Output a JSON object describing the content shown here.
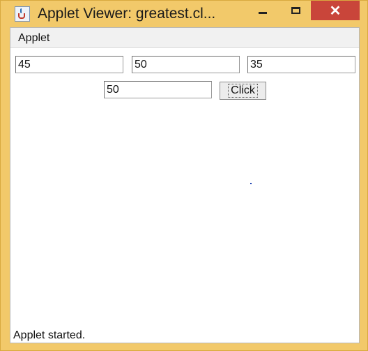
{
  "window": {
    "title": "Applet Viewer: greatest.cl...",
    "minimize_icon": "minimize-icon",
    "maximize_icon": "maximize-icon",
    "close_icon": "close-icon",
    "close_glyph": "✕",
    "app_icon": "java-cup-icon"
  },
  "menubar": {
    "applet_label": "Applet"
  },
  "inputs": {
    "first": "45",
    "second": "50",
    "third": "35"
  },
  "result": {
    "value": "50"
  },
  "button": {
    "label": "Click"
  },
  "status": {
    "text": "Applet started."
  },
  "colors": {
    "frame": "#f2c96a",
    "close": "#c9453a",
    "client": "#ffffff"
  }
}
